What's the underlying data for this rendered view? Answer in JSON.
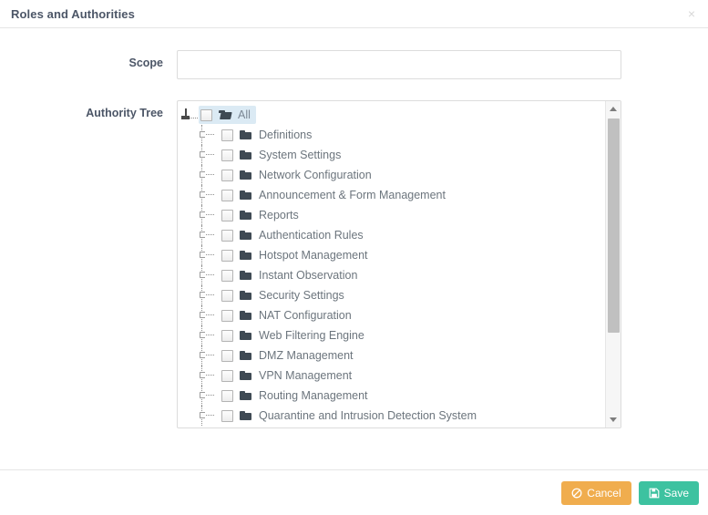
{
  "header": {
    "title": "Roles and Authorities",
    "close_icon": "close-icon",
    "close_label": "×"
  },
  "form": {
    "scope": {
      "label": "Scope",
      "value": "",
      "placeholder": ""
    },
    "authority_tree": {
      "label": "Authority Tree"
    }
  },
  "tree": {
    "root": {
      "label": "All",
      "icon": "folder-open-icon",
      "checked": false,
      "selected": true
    },
    "items": [
      {
        "label": "Definitions",
        "icon": "folder-icon",
        "checked": false
      },
      {
        "label": "System Settings",
        "icon": "folder-icon",
        "checked": false
      },
      {
        "label": "Network Configuration",
        "icon": "folder-icon",
        "checked": false
      },
      {
        "label": "Announcement & Form Management",
        "icon": "folder-icon",
        "checked": false
      },
      {
        "label": "Reports",
        "icon": "folder-icon",
        "checked": false
      },
      {
        "label": "Authentication Rules",
        "icon": "folder-icon",
        "checked": false
      },
      {
        "label": "Hotspot Management",
        "icon": "folder-icon",
        "checked": false
      },
      {
        "label": "Instant Observation",
        "icon": "folder-icon",
        "checked": false
      },
      {
        "label": "Security Settings",
        "icon": "folder-icon",
        "checked": false
      },
      {
        "label": "NAT Configuration",
        "icon": "folder-icon",
        "checked": false
      },
      {
        "label": "Web Filtering Engine",
        "icon": "folder-icon",
        "checked": false
      },
      {
        "label": "DMZ Management",
        "icon": "folder-icon",
        "checked": false
      },
      {
        "label": "VPN Management",
        "icon": "folder-icon",
        "checked": false
      },
      {
        "label": "Routing Management",
        "icon": "folder-icon",
        "checked": false
      },
      {
        "label": "Quarantine and Intrusion Detection System",
        "icon": "folder-icon",
        "checked": false
      }
    ]
  },
  "scrollbar": {
    "up_icon": "caret-up-icon",
    "down_icon": "caret-down-icon"
  },
  "footer": {
    "cancel": {
      "label": "Cancel",
      "icon": "ban-icon",
      "color": "#f0ad4e"
    },
    "save": {
      "label": "Save",
      "icon": "floppy-disk-icon",
      "color": "#3dc2a0"
    }
  }
}
